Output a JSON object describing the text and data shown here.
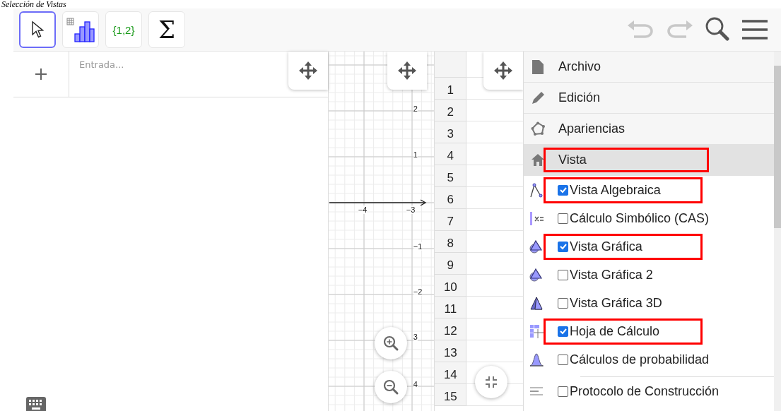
{
  "caption": "Selección de Vistas",
  "toolbar": {
    "tools": [
      {
        "kind": "pointer",
        "selected": true
      },
      {
        "kind": "chart",
        "selected": false
      },
      {
        "kind": "list",
        "label": "{1,2}",
        "selected": false
      },
      {
        "kind": "sum",
        "label": "Σ",
        "selected": false
      }
    ],
    "undo": {
      "disabled": true
    },
    "redo": {
      "disabled": true
    }
  },
  "algebra": {
    "input": {
      "placeholder": "Entrada..."
    }
  },
  "graphics": {
    "x_labels": [
      "−4",
      "−3"
    ],
    "y_labels": [
      "2",
      "1",
      "−1",
      "−2",
      "3",
      "4"
    ]
  },
  "spreadsheet": {
    "rows": [
      "1",
      "2",
      "3",
      "4",
      "5",
      "6",
      "7",
      "8",
      "9",
      "10",
      "11",
      "12",
      "13",
      "14",
      "15"
    ]
  },
  "menu": {
    "items": [
      {
        "kind": "file",
        "label": "Archivo",
        "selected": false,
        "highlighted": false
      },
      {
        "kind": "edit",
        "label": "Edición",
        "selected": false,
        "highlighted": false
      },
      {
        "kind": "appearance",
        "label": "Apariencias",
        "selected": false,
        "highlighted": false
      },
      {
        "kind": "view",
        "label": "Vista",
        "selected": true,
        "highlighted": true
      }
    ],
    "views": [
      {
        "kind": "algebra",
        "label": "Vista Algebraica",
        "checked": true,
        "highlighted": true
      },
      {
        "kind": "cas",
        "label": "Cálculo Simbólico (CAS)",
        "checked": false,
        "highlighted": false
      },
      {
        "kind": "graphics",
        "label": "Vista Gráfica",
        "checked": true,
        "highlighted": true
      },
      {
        "kind": "graphics2",
        "label": "Vista Gráfica 2",
        "checked": false,
        "highlighted": false
      },
      {
        "kind": "graphics3d",
        "label": "Vista Gráfica 3D",
        "checked": false,
        "highlighted": false
      },
      {
        "kind": "spreadsheet",
        "label": "Hoja de Cálculo",
        "checked": true,
        "highlighted": true
      },
      {
        "kind": "probability",
        "label": "Cálculos de probabilidad",
        "checked": false,
        "highlighted": false
      },
      {
        "kind": "protocol",
        "label": "Protocolo de Construcción",
        "checked": false,
        "highlighted": false
      }
    ]
  }
}
